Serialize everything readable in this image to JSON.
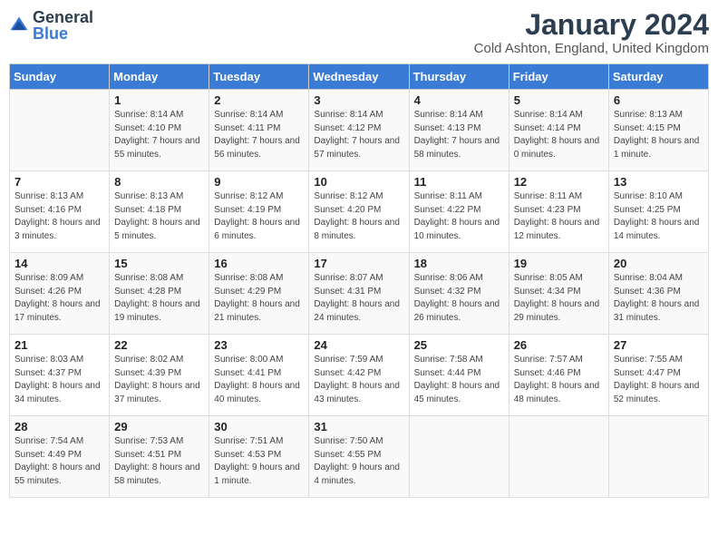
{
  "logo": {
    "text_general": "General",
    "text_blue": "Blue"
  },
  "title": "January 2024",
  "location": "Cold Ashton, England, United Kingdom",
  "days_of_week": [
    "Sunday",
    "Monday",
    "Tuesday",
    "Wednesday",
    "Thursday",
    "Friday",
    "Saturday"
  ],
  "weeks": [
    [
      {
        "day": "",
        "sunrise": "",
        "sunset": "",
        "daylight": ""
      },
      {
        "day": "1",
        "sunrise": "Sunrise: 8:14 AM",
        "sunset": "Sunset: 4:10 PM",
        "daylight": "Daylight: 7 hours and 55 minutes."
      },
      {
        "day": "2",
        "sunrise": "Sunrise: 8:14 AM",
        "sunset": "Sunset: 4:11 PM",
        "daylight": "Daylight: 7 hours and 56 minutes."
      },
      {
        "day": "3",
        "sunrise": "Sunrise: 8:14 AM",
        "sunset": "Sunset: 4:12 PM",
        "daylight": "Daylight: 7 hours and 57 minutes."
      },
      {
        "day": "4",
        "sunrise": "Sunrise: 8:14 AM",
        "sunset": "Sunset: 4:13 PM",
        "daylight": "Daylight: 7 hours and 58 minutes."
      },
      {
        "day": "5",
        "sunrise": "Sunrise: 8:14 AM",
        "sunset": "Sunset: 4:14 PM",
        "daylight": "Daylight: 8 hours and 0 minutes."
      },
      {
        "day": "6",
        "sunrise": "Sunrise: 8:13 AM",
        "sunset": "Sunset: 4:15 PM",
        "daylight": "Daylight: 8 hours and 1 minute."
      }
    ],
    [
      {
        "day": "7",
        "sunrise": "Sunrise: 8:13 AM",
        "sunset": "Sunset: 4:16 PM",
        "daylight": "Daylight: 8 hours and 3 minutes."
      },
      {
        "day": "8",
        "sunrise": "Sunrise: 8:13 AM",
        "sunset": "Sunset: 4:18 PM",
        "daylight": "Daylight: 8 hours and 5 minutes."
      },
      {
        "day": "9",
        "sunrise": "Sunrise: 8:12 AM",
        "sunset": "Sunset: 4:19 PM",
        "daylight": "Daylight: 8 hours and 6 minutes."
      },
      {
        "day": "10",
        "sunrise": "Sunrise: 8:12 AM",
        "sunset": "Sunset: 4:20 PM",
        "daylight": "Daylight: 8 hours and 8 minutes."
      },
      {
        "day": "11",
        "sunrise": "Sunrise: 8:11 AM",
        "sunset": "Sunset: 4:22 PM",
        "daylight": "Daylight: 8 hours and 10 minutes."
      },
      {
        "day": "12",
        "sunrise": "Sunrise: 8:11 AM",
        "sunset": "Sunset: 4:23 PM",
        "daylight": "Daylight: 8 hours and 12 minutes."
      },
      {
        "day": "13",
        "sunrise": "Sunrise: 8:10 AM",
        "sunset": "Sunset: 4:25 PM",
        "daylight": "Daylight: 8 hours and 14 minutes."
      }
    ],
    [
      {
        "day": "14",
        "sunrise": "Sunrise: 8:09 AM",
        "sunset": "Sunset: 4:26 PM",
        "daylight": "Daylight: 8 hours and 17 minutes."
      },
      {
        "day": "15",
        "sunrise": "Sunrise: 8:08 AM",
        "sunset": "Sunset: 4:28 PM",
        "daylight": "Daylight: 8 hours and 19 minutes."
      },
      {
        "day": "16",
        "sunrise": "Sunrise: 8:08 AM",
        "sunset": "Sunset: 4:29 PM",
        "daylight": "Daylight: 8 hours and 21 minutes."
      },
      {
        "day": "17",
        "sunrise": "Sunrise: 8:07 AM",
        "sunset": "Sunset: 4:31 PM",
        "daylight": "Daylight: 8 hours and 24 minutes."
      },
      {
        "day": "18",
        "sunrise": "Sunrise: 8:06 AM",
        "sunset": "Sunset: 4:32 PM",
        "daylight": "Daylight: 8 hours and 26 minutes."
      },
      {
        "day": "19",
        "sunrise": "Sunrise: 8:05 AM",
        "sunset": "Sunset: 4:34 PM",
        "daylight": "Daylight: 8 hours and 29 minutes."
      },
      {
        "day": "20",
        "sunrise": "Sunrise: 8:04 AM",
        "sunset": "Sunset: 4:36 PM",
        "daylight": "Daylight: 8 hours and 31 minutes."
      }
    ],
    [
      {
        "day": "21",
        "sunrise": "Sunrise: 8:03 AM",
        "sunset": "Sunset: 4:37 PM",
        "daylight": "Daylight: 8 hours and 34 minutes."
      },
      {
        "day": "22",
        "sunrise": "Sunrise: 8:02 AM",
        "sunset": "Sunset: 4:39 PM",
        "daylight": "Daylight: 8 hours and 37 minutes."
      },
      {
        "day": "23",
        "sunrise": "Sunrise: 8:00 AM",
        "sunset": "Sunset: 4:41 PM",
        "daylight": "Daylight: 8 hours and 40 minutes."
      },
      {
        "day": "24",
        "sunrise": "Sunrise: 7:59 AM",
        "sunset": "Sunset: 4:42 PM",
        "daylight": "Daylight: 8 hours and 43 minutes."
      },
      {
        "day": "25",
        "sunrise": "Sunrise: 7:58 AM",
        "sunset": "Sunset: 4:44 PM",
        "daylight": "Daylight: 8 hours and 45 minutes."
      },
      {
        "day": "26",
        "sunrise": "Sunrise: 7:57 AM",
        "sunset": "Sunset: 4:46 PM",
        "daylight": "Daylight: 8 hours and 48 minutes."
      },
      {
        "day": "27",
        "sunrise": "Sunrise: 7:55 AM",
        "sunset": "Sunset: 4:47 PM",
        "daylight": "Daylight: 8 hours and 52 minutes."
      }
    ],
    [
      {
        "day": "28",
        "sunrise": "Sunrise: 7:54 AM",
        "sunset": "Sunset: 4:49 PM",
        "daylight": "Daylight: 8 hours and 55 minutes."
      },
      {
        "day": "29",
        "sunrise": "Sunrise: 7:53 AM",
        "sunset": "Sunset: 4:51 PM",
        "daylight": "Daylight: 8 hours and 58 minutes."
      },
      {
        "day": "30",
        "sunrise": "Sunrise: 7:51 AM",
        "sunset": "Sunset: 4:53 PM",
        "daylight": "Daylight: 9 hours and 1 minute."
      },
      {
        "day": "31",
        "sunrise": "Sunrise: 7:50 AM",
        "sunset": "Sunset: 4:55 PM",
        "daylight": "Daylight: 9 hours and 4 minutes."
      },
      {
        "day": "",
        "sunrise": "",
        "sunset": "",
        "daylight": ""
      },
      {
        "day": "",
        "sunrise": "",
        "sunset": "",
        "daylight": ""
      },
      {
        "day": "",
        "sunrise": "",
        "sunset": "",
        "daylight": ""
      }
    ]
  ]
}
